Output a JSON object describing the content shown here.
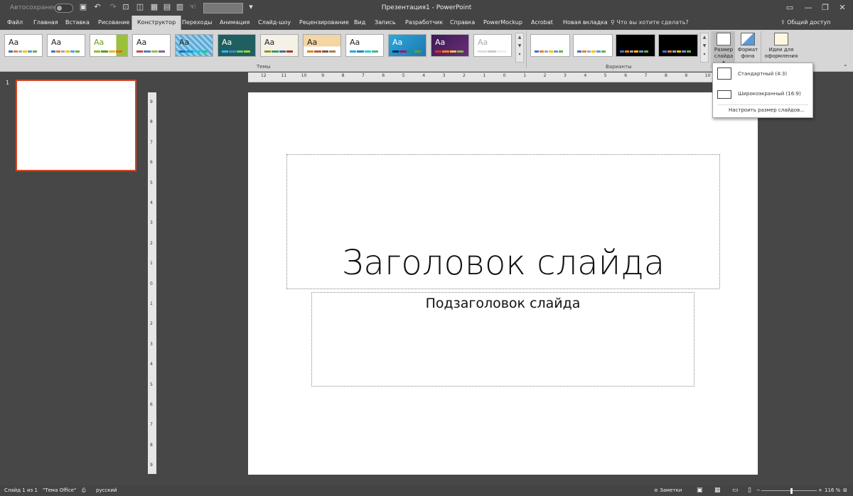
{
  "titlebar": {
    "autosave": "Автосохранение",
    "window_title": "Презентация1  -  PowerPoint",
    "qat_icons": [
      "save-icon",
      "undo-icon",
      "redo-icon",
      "format-painter-icon",
      "shape-icon",
      "grid-icon",
      "align-icon",
      "touch-icon",
      "more-icon"
    ]
  },
  "tabs": [
    "Файл",
    "Главная",
    "Вставка",
    "Рисование",
    "Конструктор",
    "Переходы",
    "Анимация",
    "Слайд-шоу",
    "Рецензирование",
    "Вид",
    "Запись",
    "Разработчик",
    "Справка",
    "PowerMockup",
    "Acrobat",
    "Новая вкладка"
  ],
  "active_tab": "Конструктор",
  "tell_me": "Что вы хотите сделать?",
  "share": "Общий доступ",
  "ribbon": {
    "themes_label": "Темы",
    "variants_label": "Варианты",
    "theme_glyph": "Aa",
    "slide_size_btn": "Размер слайда",
    "format_bg_btn": "Формат фона",
    "design_ideas_btn": "Идеи для оформления"
  },
  "colors": {
    "accent": "#d24726",
    "ribbon_bg": "#d6d6d6",
    "chrome": "#444444"
  },
  "panel": {
    "slide_number": "1"
  },
  "slide": {
    "title": "Заголовок слайда",
    "subtitle": "Подзаголовок слайда"
  },
  "dropdown": {
    "item1": "Стандартный (4:3)",
    "item2": "Широкоэкранный (16:9)",
    "item3": "Настроить размер слайдов..."
  },
  "ruler_labels": [
    "12",
    "11",
    "10",
    "9",
    "8",
    "7",
    "6",
    "5",
    "4",
    "3",
    "2",
    "1",
    "0",
    "1",
    "2",
    "3",
    "4",
    "5",
    "6",
    "7",
    "8",
    "9",
    "10",
    "11",
    "12"
  ],
  "vruler_labels": [
    "9",
    "8",
    "7",
    "6",
    "5",
    "4",
    "3",
    "2",
    "1",
    "0",
    "1",
    "2",
    "3",
    "4",
    "5",
    "6",
    "7",
    "8",
    "9"
  ],
  "status": {
    "slide_of": "Слайд 1 из 1",
    "theme": "\"Тема Office\"",
    "language": "русский",
    "notes": "Заметки",
    "zoom": "116 %"
  }
}
